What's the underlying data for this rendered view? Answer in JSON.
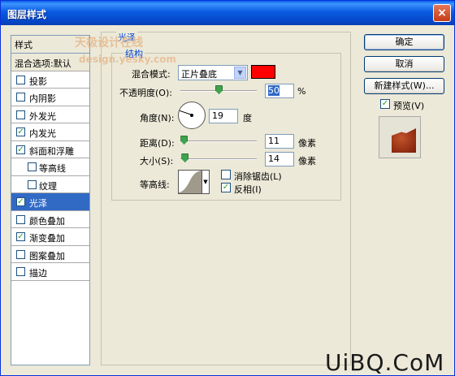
{
  "window": {
    "title": "图层样式",
    "close_label": "×"
  },
  "style_list": {
    "header": "样式",
    "items": [
      {
        "label": "混合选项:默认",
        "checked": null,
        "sub": false,
        "selected": false
      },
      {
        "label": "投影",
        "checked": false,
        "sub": false,
        "selected": false
      },
      {
        "label": "内阴影",
        "checked": false,
        "sub": false,
        "selected": false
      },
      {
        "label": "外发光",
        "checked": false,
        "sub": false,
        "selected": false
      },
      {
        "label": "内发光",
        "checked": true,
        "sub": false,
        "selected": false
      },
      {
        "label": "斜面和浮雕",
        "checked": true,
        "sub": false,
        "selected": false
      },
      {
        "label": "等高线",
        "checked": false,
        "sub": true,
        "selected": false
      },
      {
        "label": "纹理",
        "checked": false,
        "sub": true,
        "selected": false
      },
      {
        "label": "光泽",
        "checked": true,
        "sub": false,
        "selected": true
      },
      {
        "label": "颜色叠加",
        "checked": false,
        "sub": false,
        "selected": false
      },
      {
        "label": "渐变叠加",
        "checked": true,
        "sub": false,
        "selected": false
      },
      {
        "label": "图案叠加",
        "checked": false,
        "sub": false,
        "selected": false
      },
      {
        "label": "描边",
        "checked": false,
        "sub": false,
        "selected": false
      }
    ]
  },
  "panel": {
    "group_title": "光泽",
    "structure_title": "结构",
    "blend_mode_label": "混合模式:",
    "blend_mode_value": "正片叠底",
    "blend_color": "#ff0000",
    "opacity_label": "不透明度(O):",
    "opacity_value": "50",
    "opacity_unit": "%",
    "opacity_level": 50,
    "angle_label": "角度(N):",
    "angle_value": "19",
    "angle_unit": "度",
    "distance_label": "距离(D):",
    "distance_value": "11",
    "distance_unit": "像素",
    "distance_level": 11,
    "size_label": "大小(S):",
    "size_value": "14",
    "size_unit": "像素",
    "size_level": 14,
    "contour_label": "等高线:",
    "anti_alias_label": "消除锯齿(L)",
    "anti_alias_checked": false,
    "invert_label": "反相(I)",
    "invert_checked": true
  },
  "buttons": {
    "ok": "确定",
    "cancel": "取消",
    "new_style": "新建样式(W)...",
    "preview_label": "预览(V)",
    "preview_checked": true
  },
  "watermarks": {
    "top": "天极设计在线",
    "url": "design.yesky.com",
    "bottom": "UiBQ.CoM"
  }
}
